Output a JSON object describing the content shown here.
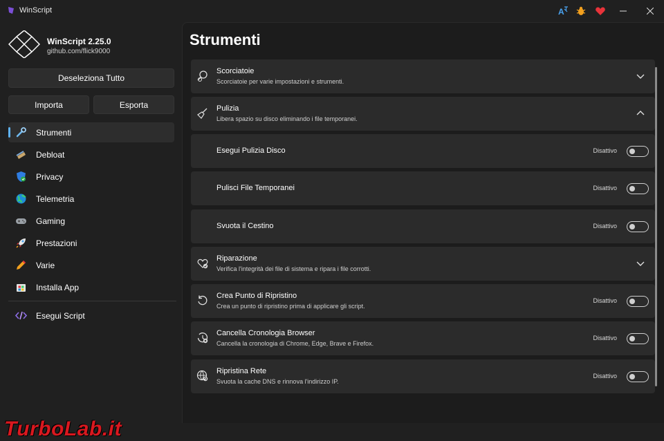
{
  "window": {
    "title": "WinScript"
  },
  "brand": {
    "name": "WinScript 2.25.0",
    "subtitle": "github.com/flick9000"
  },
  "sidebar": {
    "deselect_label": "Deseleziona Tutto",
    "import_label": "Importa",
    "export_label": "Esporta",
    "items": [
      {
        "label": "Strumenti",
        "icon": "wrench-icon",
        "active": true
      },
      {
        "label": "Debloat",
        "icon": "broom-icon"
      },
      {
        "label": "Privacy",
        "icon": "shield-icon"
      },
      {
        "label": "Telemetria",
        "icon": "globe-icon"
      },
      {
        "label": "Gaming",
        "icon": "gamepad-icon"
      },
      {
        "label": "Prestazioni",
        "icon": "rocket-icon"
      },
      {
        "label": "Varie",
        "icon": "pencil-icon"
      },
      {
        "label": "Installa App",
        "icon": "app-store-icon"
      }
    ],
    "run_label": "Esegui Script"
  },
  "main": {
    "title": "Strumenti",
    "sections": [
      {
        "title": "Scorciatoie",
        "desc": "Scorciatoie per varie impostazioni e strumenti.",
        "expanded": false
      },
      {
        "title": "Pulizia",
        "desc": "Libera spazio su disco eliminando i file temporanei.",
        "expanded": true
      },
      {
        "title": "Riparazione",
        "desc": "Verifica l'integrità dei file di sistema e ripara i file corrotti.",
        "expanded": false
      }
    ],
    "cleanup_items": [
      {
        "title": "Esegui Pulizia Disco",
        "status": "Disattivo"
      },
      {
        "title": "Pulisci File Temporanei",
        "status": "Disattivo"
      },
      {
        "title": "Svuota il Cestino",
        "status": "Disattivo"
      }
    ],
    "tools": [
      {
        "title": "Crea Punto di Ripristino",
        "desc": "Crea un punto di ripristino prima di applicare gli script.",
        "status": "Disattivo"
      },
      {
        "title": "Cancella Cronologia Browser",
        "desc": "Cancella la cronologia di Chrome, Edge, Brave e Firefox.",
        "status": "Disattivo"
      },
      {
        "title": "Ripristina Rete",
        "desc": "Svuota la cache DNS e rinnova l'indirizzo IP.",
        "status": "Disattivo"
      }
    ]
  },
  "colors": {
    "accent": "#5fb2f2",
    "background": "#202020",
    "card": "#2b2b2b"
  },
  "watermark": "TurboLab.it"
}
